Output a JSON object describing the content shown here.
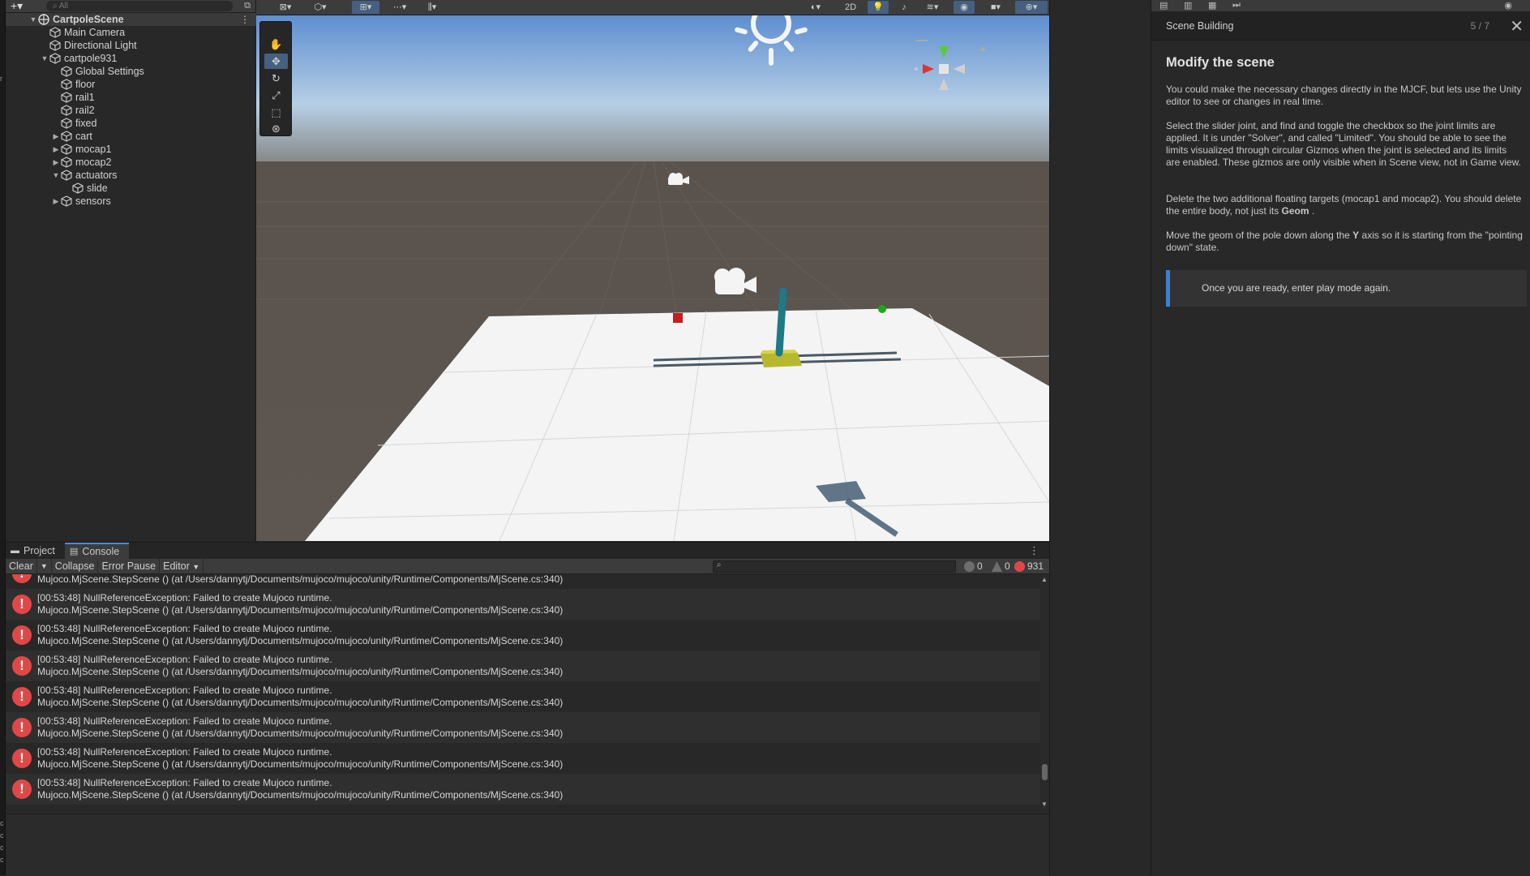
{
  "hierarchy": {
    "search_placeholder": "All",
    "scene_name": "CartpoleScene",
    "items": [
      {
        "label": "Main Camera"
      },
      {
        "label": "Directional Light"
      },
      {
        "label": "cartpole931"
      },
      {
        "label": "Global Settings"
      },
      {
        "label": "floor"
      },
      {
        "label": "rail1"
      },
      {
        "label": "rail2"
      },
      {
        "label": "fixed"
      },
      {
        "label": "cart"
      },
      {
        "label": "mocap1"
      },
      {
        "label": "mocap2"
      },
      {
        "label": "actuators"
      },
      {
        "label": "slide"
      },
      {
        "label": "sensors"
      }
    ]
  },
  "scene_toolbar": {
    "mode_2d": "2D"
  },
  "bottom": {
    "tabs": [
      {
        "label": "Project"
      },
      {
        "label": "Console"
      }
    ],
    "toolbar": {
      "clear": "Clear",
      "collapse": "Collapse",
      "error_pause": "Error Pause",
      "editor": "Editor"
    },
    "counts": {
      "info": "0",
      "warnings": "0",
      "errors": "931"
    },
    "log_entries": [
      {
        "line1": "",
        "line2": "Mujoco.MjScene.StepScene () (at /Users/dannytj/Documents/mujoco/mujoco/unity/Runtime/Components/MjScene.cs:340)"
      },
      {
        "line1": "[00:53:48] NullReferenceException: Failed to create Mujoco runtime.",
        "line2": "Mujoco.MjScene.StepScene () (at /Users/dannytj/Documents/mujoco/mujoco/unity/Runtime/Components/MjScene.cs:340)"
      },
      {
        "line1": "[00:53:48] NullReferenceException: Failed to create Mujoco runtime.",
        "line2": "Mujoco.MjScene.StepScene () (at /Users/dannytj/Documents/mujoco/mujoco/unity/Runtime/Components/MjScene.cs:340)"
      },
      {
        "line1": "[00:53:48] NullReferenceException: Failed to create Mujoco runtime.",
        "line2": "Mujoco.MjScene.StepScene () (at /Users/dannytj/Documents/mujoco/mujoco/unity/Runtime/Components/MjScene.cs:340)"
      },
      {
        "line1": "[00:53:48] NullReferenceException: Failed to create Mujoco runtime.",
        "line2": "Mujoco.MjScene.StepScene () (at /Users/dannytj/Documents/mujoco/mujoco/unity/Runtime/Components/MjScene.cs:340)"
      },
      {
        "line1": "[00:53:48] NullReferenceException: Failed to create Mujoco runtime.",
        "line2": "Mujoco.MjScene.StepScene () (at /Users/dannytj/Documents/mujoco/mujoco/unity/Runtime/Components/MjScene.cs:340)"
      },
      {
        "line1": "[00:53:48] NullReferenceException: Failed to create Mujoco runtime.",
        "line2": "Mujoco.MjScene.StepScene () (at /Users/dannytj/Documents/mujoco/mujoco/unity/Runtime/Components/MjScene.cs:340)"
      },
      {
        "line1": "[00:53:48] NullReferenceException: Failed to create Mujoco runtime.",
        "line2": "Mujoco.MjScene.StepScene () (at /Users/dannytj/Documents/mujoco/mujoco/unity/Runtime/Components/MjScene.cs:340)"
      }
    ]
  },
  "tutorial": {
    "section": "Scene Building",
    "progress": "5 / 7",
    "title": "Modify the scene",
    "paragraphs": [
      "You could make the necessary changes directly in the MJCF, but lets use the Unity editor to see or changes in real time.",
      "Select the slider joint, and find and toggle the checkbox so the joint limits are applied. It is under \"Solver\", and called \"Limited\". You should be able to see the limits visualized through circular Gizmos when the joint is selected and its limits are enabled. These gizmos are only visible when in Scene view, not in Game view.",
      "Delete the two additional floating targets (mocap1 and mocap2). You should delete the entire body, not just its",
      "Move the geom of the pole down along the",
      "axis so it is starting from the \"pointing down\" state."
    ],
    "bold_geom": "Geom",
    "bold_y": "Y",
    "callout": "Once you are ready, enter play mode again."
  },
  "colors": {
    "accent": "#3e7fcf",
    "error": "#e04848",
    "warning_dot": "#888888",
    "panel_bg": "#282828"
  }
}
